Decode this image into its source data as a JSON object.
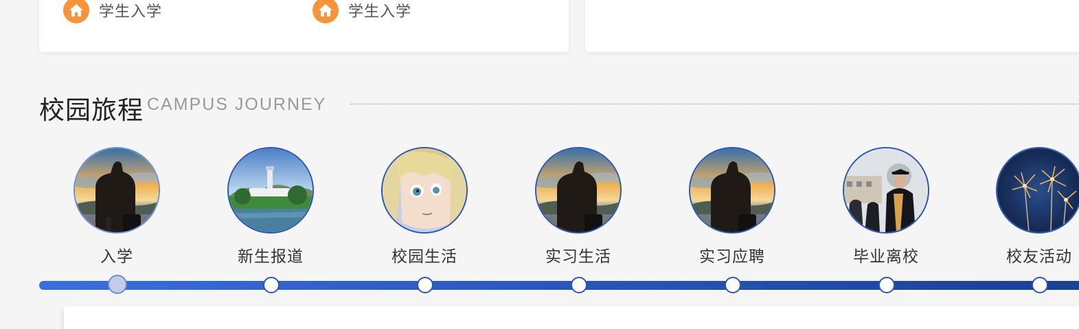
{
  "top_links": [
    {
      "icon": "home-icon",
      "label": "学生入学"
    },
    {
      "icon": "home-icon",
      "label": "学生入学"
    }
  ],
  "section": {
    "title": "校园旅程",
    "subtitle": "CAMPUS JOURNEY"
  },
  "stages": [
    {
      "label": "入学",
      "image": "silhouette-sunset-photo",
      "active": true
    },
    {
      "label": "新生报道",
      "image": "campus-tower-lake-photo",
      "active": false
    },
    {
      "label": "校园生活",
      "image": "anime-character-image",
      "active": false
    },
    {
      "label": "实习生活",
      "image": "silhouette-sunset-photo",
      "active": false
    },
    {
      "label": "实习应聘",
      "image": "silhouette-sunset-photo",
      "active": false
    },
    {
      "label": "毕业离校",
      "image": "graduate-cap-gown-photo",
      "active": false
    },
    {
      "label": "校友活动",
      "image": "sparklers-photo",
      "active": false
    }
  ],
  "colors": {
    "accent_orange": "#f7933b",
    "timeline_blue": "#2453b3",
    "active_ring": "#6a8fd8"
  }
}
